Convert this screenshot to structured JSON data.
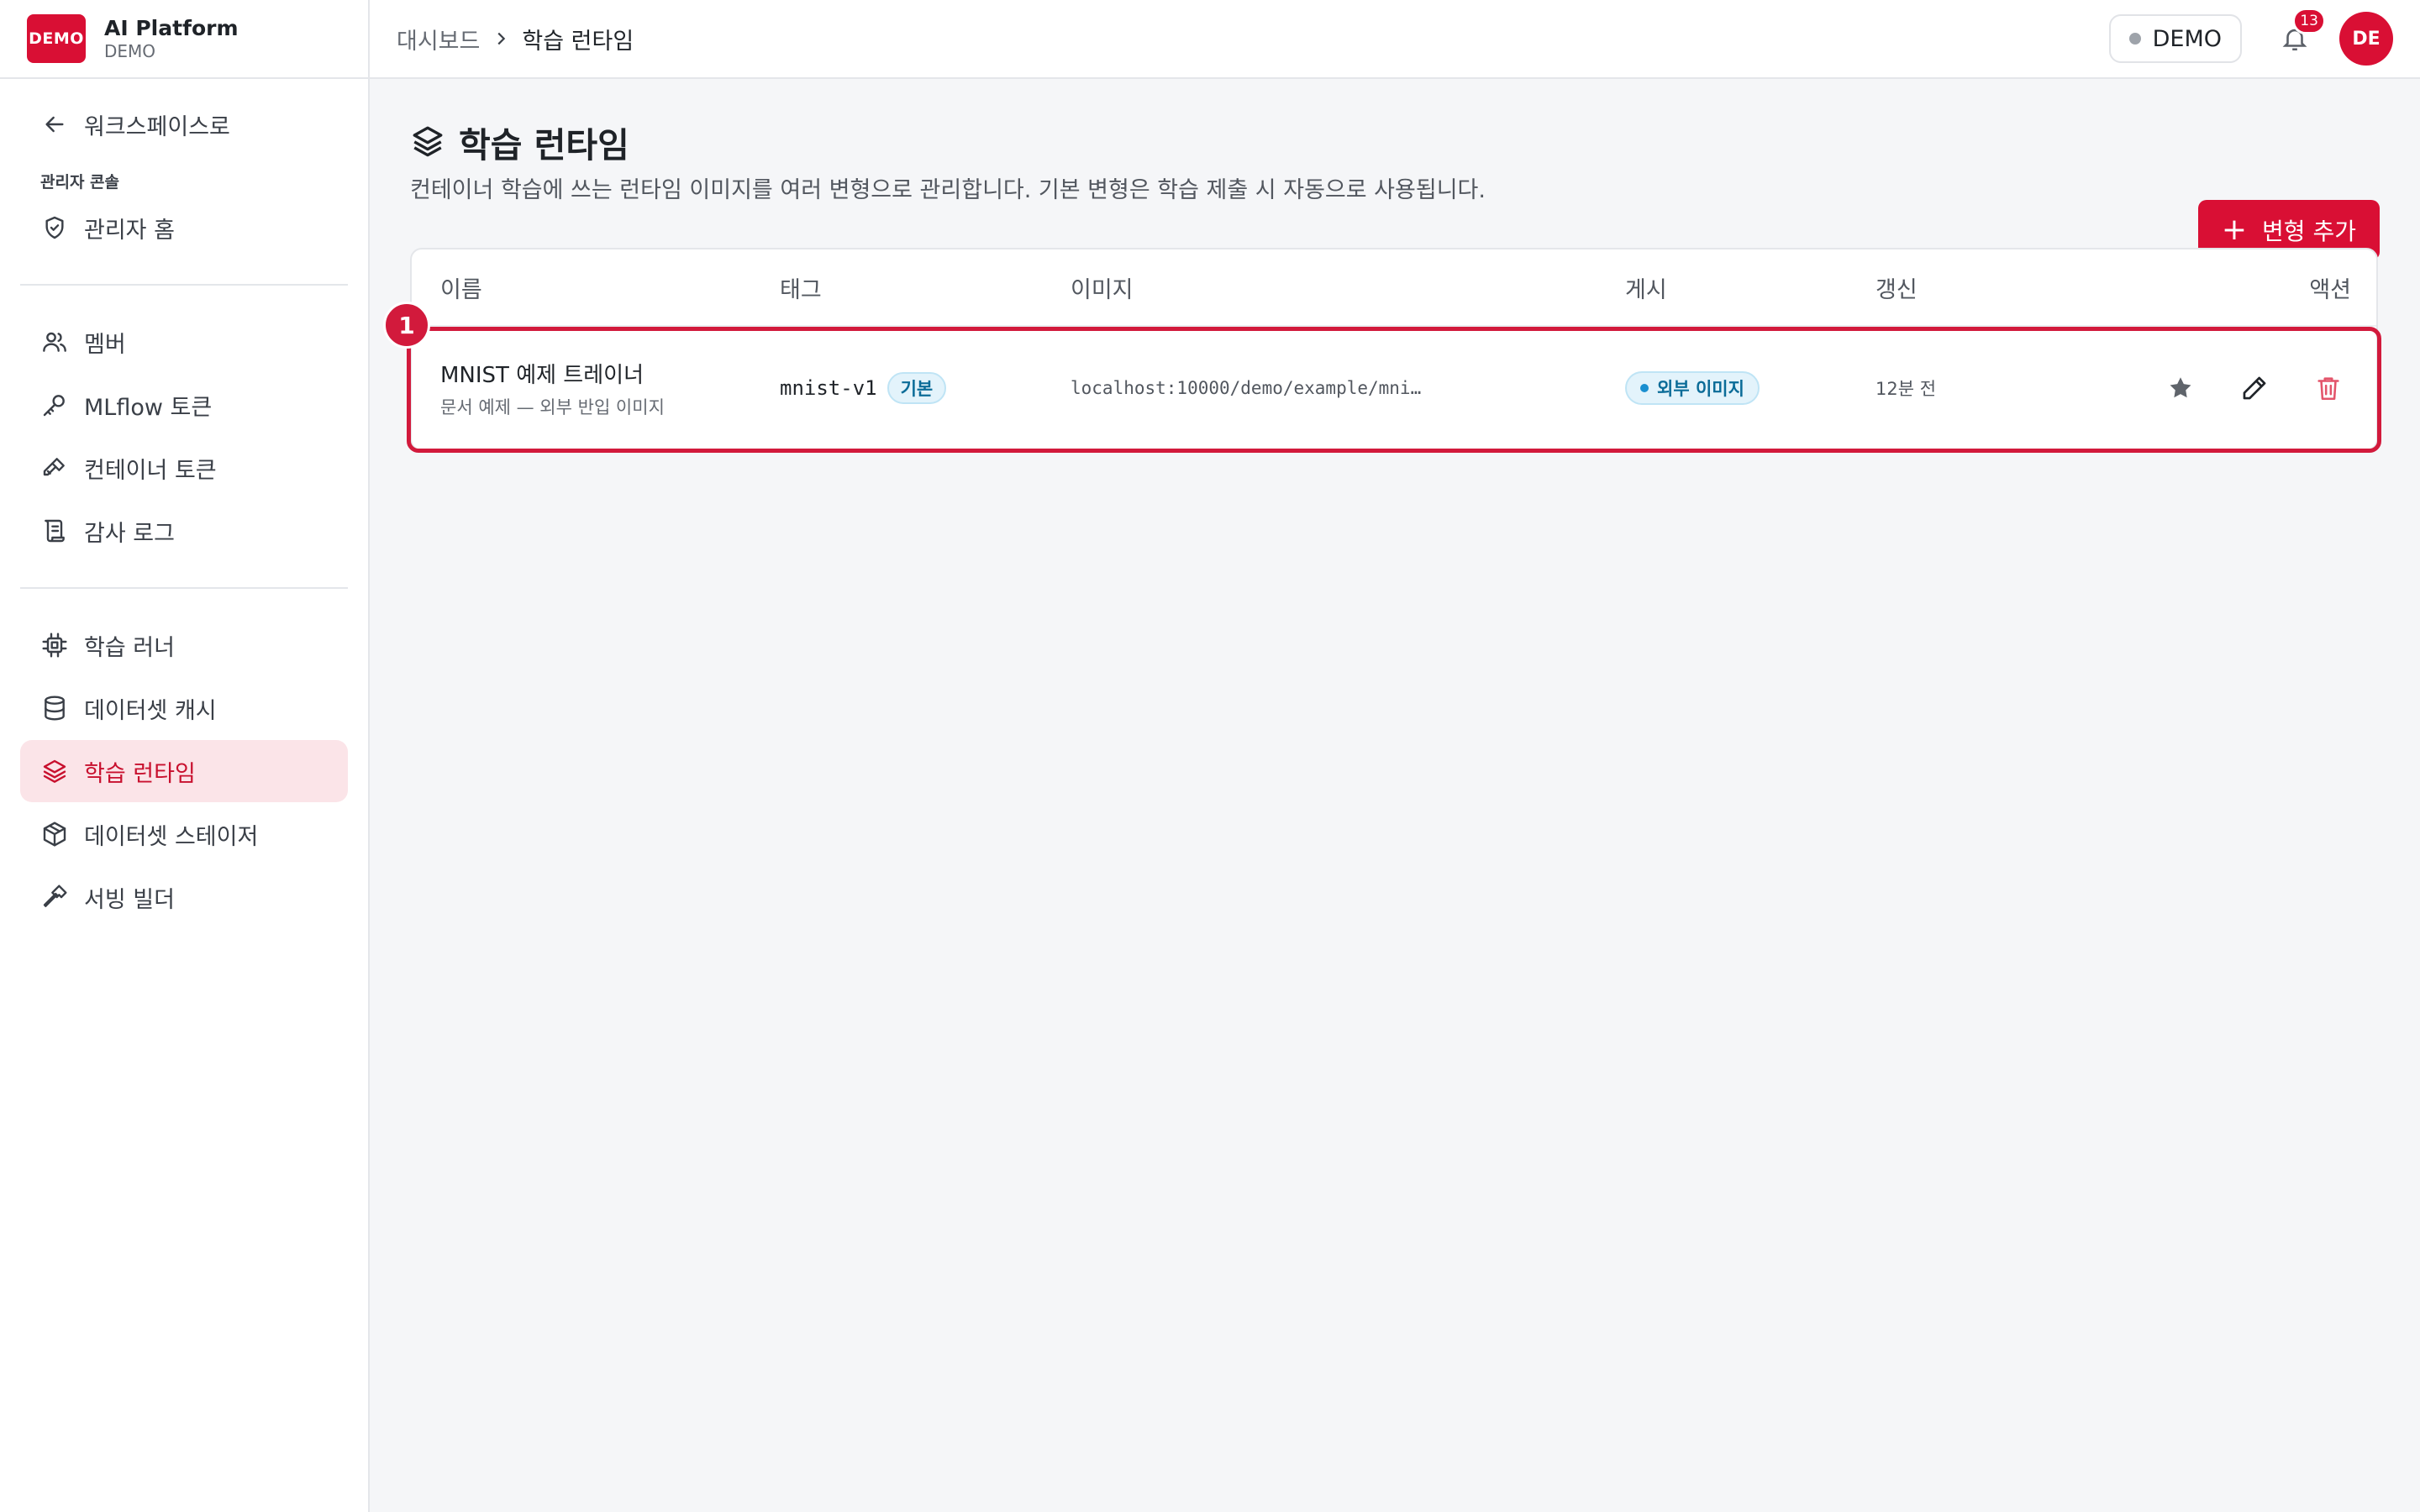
{
  "brand": {
    "logo": "DEMO",
    "title": "AI Platform",
    "subtitle": "DEMO"
  },
  "sidebar": {
    "back_label": "워크스페이스로",
    "section_title": "관리자 콘솔",
    "items": [
      {
        "label": "관리자 홈",
        "icon": "shield-icon"
      },
      {
        "label": "멤버",
        "icon": "users-icon"
      },
      {
        "label": "MLflow 토큰",
        "icon": "key-icon"
      },
      {
        "label": "컨테이너 토큰",
        "icon": "key-icon"
      },
      {
        "label": "감사 로그",
        "icon": "scroll-icon"
      },
      {
        "label": "학습 러너",
        "icon": "cpu-icon"
      },
      {
        "label": "데이터셋 캐시",
        "icon": "database-icon"
      },
      {
        "label": "학습 런타임",
        "icon": "layers-icon",
        "active": true
      },
      {
        "label": "데이터셋 스테이저",
        "icon": "box-icon"
      },
      {
        "label": "서빙 빌더",
        "icon": "hammer-icon"
      }
    ]
  },
  "topbar": {
    "breadcrumb": {
      "parent": "대시보드",
      "current": "학습 런타임"
    },
    "env_label": "DEMO",
    "notification_count": "13",
    "avatar_initials": "DE"
  },
  "page": {
    "title": "학습 런타임",
    "description": "컨테이너 학습에 쓰는 런타임 이미지를 여러 변형으로 관리합니다. 기본 변형은 학습 제출 시 자동으로 사용됩니다.",
    "add_button": "변형 추가"
  },
  "table": {
    "columns": {
      "name": "이름",
      "tag": "태그",
      "image": "이미지",
      "published": "게시",
      "updated": "갱신",
      "actions": "액션"
    },
    "rows": [
      {
        "marker": "1",
        "name": "MNIST 예제 트레이너",
        "description": "문서 예제 — 외부 반입 이미지",
        "tag": "mnist-v1",
        "tag_badge": "기본",
        "image": "localhost:10000/demo/example/mni…",
        "published": "외부 이미지",
        "updated": "12분 전"
      }
    ]
  },
  "colors": {
    "accent": "#d90f34",
    "active_bg": "#fbe4e8",
    "info": "#0b6c98"
  }
}
